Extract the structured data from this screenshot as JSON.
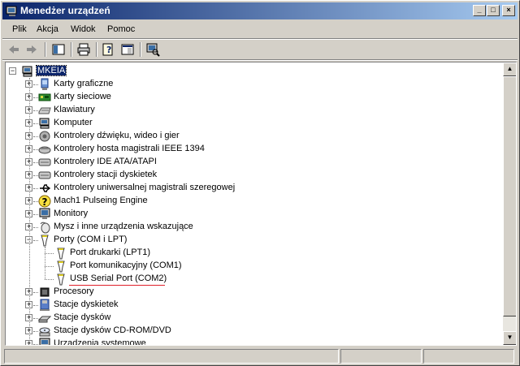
{
  "window": {
    "title": "Menedżer urządzeń"
  },
  "menu": [
    {
      "label": "Plik"
    },
    {
      "label": "Akcja"
    },
    {
      "label": "Widok"
    },
    {
      "label": "Pomoc"
    }
  ],
  "toolbar": {
    "icons": [
      "back-arrow-icon",
      "forward-arrow-icon",
      "console-tree-icon",
      "print-icon",
      "help-icon",
      "properties-icon",
      "scan-hardware-icon"
    ]
  },
  "tree": {
    "root": {
      "label": "MKEIA"
    },
    "items": [
      {
        "label": "Karty graficzne",
        "icon": "display-adapter-icon"
      },
      {
        "label": "Karty sieciowe",
        "icon": "network-adapter-icon"
      },
      {
        "label": "Klawiatury",
        "icon": "keyboard-icon"
      },
      {
        "label": "Komputer",
        "icon": "computer-icon"
      },
      {
        "label": "Kontrolery dźwięku, wideo i gier",
        "icon": "sound-icon"
      },
      {
        "label": "Kontrolery hosta magistrali IEEE 1394",
        "icon": "ieee1394-icon"
      },
      {
        "label": "Kontrolery IDE ATA/ATAPI",
        "icon": "ide-controller-icon"
      },
      {
        "label": "Kontrolery stacji dyskietek",
        "icon": "floppy-controller-icon"
      },
      {
        "label": "Kontrolery uniwersalnej magistrali szeregowej",
        "icon": "usb-controller-icon"
      },
      {
        "label": "Mach1 Pulseing Engine",
        "icon": "unknown-device-icon"
      },
      {
        "label": "Monitory",
        "icon": "monitor-icon"
      },
      {
        "label": "Mysz i inne urządzenia wskazujące",
        "icon": "mouse-icon"
      },
      {
        "label": "Porty (COM i LPT)",
        "icon": "port-icon",
        "expanded": true,
        "children": [
          {
            "label": "Port drukarki (LPT1)",
            "icon": "port-icon"
          },
          {
            "label": "Port komunikacyjny (COM1)",
            "icon": "port-icon"
          },
          {
            "label": "USB Serial Port (COM2)",
            "icon": "port-icon"
          }
        ]
      },
      {
        "label": "Procesory",
        "icon": "processor-icon"
      },
      {
        "label": "Stacje dyskietek",
        "icon": "floppy-drive-icon"
      },
      {
        "label": "Stacje dysków",
        "icon": "disk-drive-icon"
      },
      {
        "label": "Stacje dysków CD-ROM/DVD",
        "icon": "cdrom-icon"
      },
      {
        "label": "Urządzenia systemowe",
        "icon": "system-device-icon"
      }
    ]
  },
  "colors": {
    "title_start": "#0a246a",
    "title_end": "#a6caf0",
    "selection": "#0a246a",
    "highlight_underline": "#e0202a"
  }
}
